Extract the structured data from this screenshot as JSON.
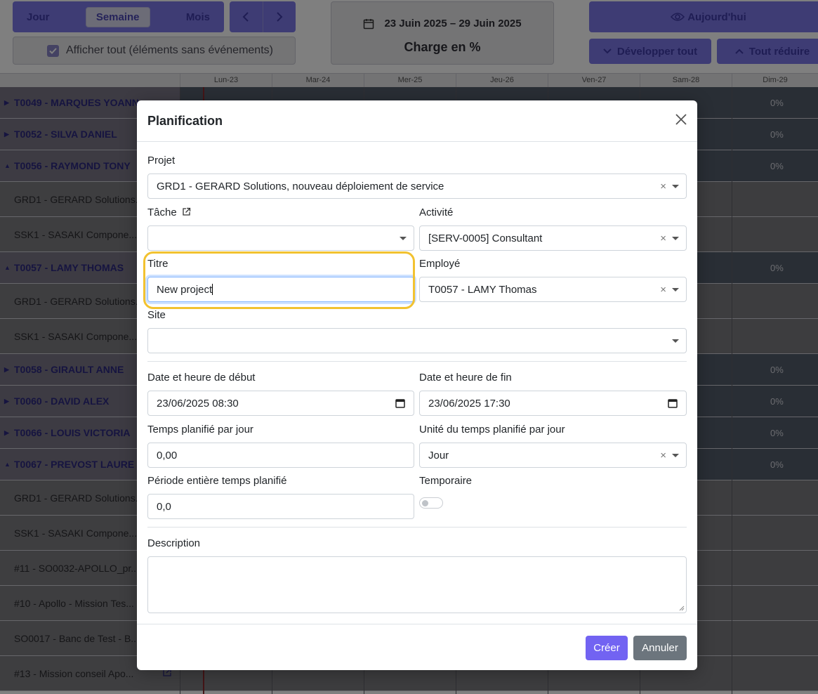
{
  "toolbar": {
    "views": [
      "Jour",
      "Semaine",
      "Mois"
    ],
    "active_view": "Semaine",
    "show_all_label": "Afficher tout (éléments sans événements)",
    "date_range": "23 Juin 2025 – 29 Juin 2025",
    "charge_label": "Charge en %",
    "today_label": "Aujourd'hui",
    "expand_label": "Développer tout",
    "collapse_label": "Tout réduire"
  },
  "gantt": {
    "days": [
      "Lun-23",
      "Mar-24",
      "Mer-25",
      "Jeu-26",
      "Ven-27",
      "Sam-28",
      "Dim-29"
    ],
    "rows": [
      {
        "label": "T0049 - MARQUES YOANN",
        "type": "group",
        "expanded": false,
        "pct": "0%"
      },
      {
        "label": "T0052 - SILVA DANIEL",
        "type": "group",
        "expanded": false,
        "pct": "0%"
      },
      {
        "label": "T0056 - RAYMOND TONY",
        "type": "group",
        "expanded": true,
        "pct": "0%"
      },
      {
        "label": "GRD1 - GERARD Solutions...",
        "type": "sub"
      },
      {
        "label": "SSK1 - SASAKI Compone...",
        "type": "sub"
      },
      {
        "label": "T0057 - LAMY THOMAS",
        "type": "group",
        "expanded": true,
        "pct": "0%"
      },
      {
        "label": "GRD1 - GERARD Solutions...",
        "type": "sub"
      },
      {
        "label": "SSK1 - SASAKI Compone...",
        "type": "sub"
      },
      {
        "label": "T0058 - GIRAULT ANNE",
        "type": "group",
        "expanded": false,
        "pct": "0%"
      },
      {
        "label": "T0060 - DAVID ALEX",
        "type": "group",
        "expanded": false,
        "pct": "0%"
      },
      {
        "label": "T0066 - LOUIS VICTORIA",
        "type": "group",
        "expanded": false,
        "pct": "0%"
      },
      {
        "label": "T0067 - PREVOST LAURE",
        "type": "group",
        "expanded": true,
        "pct": "0%"
      },
      {
        "label": "GRD1 - GERARD Solutions...",
        "type": "sub"
      },
      {
        "label": "SSK1 - SASAKI Compone...",
        "type": "sub"
      },
      {
        "label": "#11 - SO0032-APOLLO_pr...",
        "type": "sub"
      },
      {
        "label": "#10 - Apollo - Mission Tes...",
        "type": "sub"
      },
      {
        "label": "SO0017 - Banc de Test - B...",
        "type": "sub"
      },
      {
        "label": "#13 - Mission conseil Apo...",
        "type": "sub"
      }
    ]
  },
  "modal": {
    "title": "Planification",
    "project_label": "Projet",
    "project_value": "GRD1 - GERARD Solutions, nouveau déploiement de service",
    "task_label": "Tâche",
    "task_value": "",
    "activity_label": "Activité",
    "activity_value": "[SERV-0005] Consultant",
    "title_label": "Titre",
    "title_value": "New project",
    "employee_label": "Employé",
    "employee_value": "T0057 - LAMY Thomas",
    "site_label": "Site",
    "site_value": "",
    "start_label": "Date et heure de début",
    "start_value": "23/06/2025 08:30",
    "end_label": "Date et heure de fin",
    "end_value": "23/06/2025 17:30",
    "time_per_day_label": "Temps planifié par jour",
    "time_per_day_value": "0,00",
    "unit_label": "Unité du temps planifié par jour",
    "unit_value": "Jour",
    "whole_period_label": "Période entière temps planifié",
    "whole_period_value": "0,0",
    "temporary_label": "Temporaire",
    "temporary_on": false,
    "description_label": "Description",
    "description_value": "",
    "create_label": "Créer",
    "cancel_label": "Annuler"
  },
  "colors": {
    "accent": "#7263f2",
    "toolbar": "#7c79e8",
    "highlight": "#f2c230",
    "cancel": "#6c757d"
  }
}
